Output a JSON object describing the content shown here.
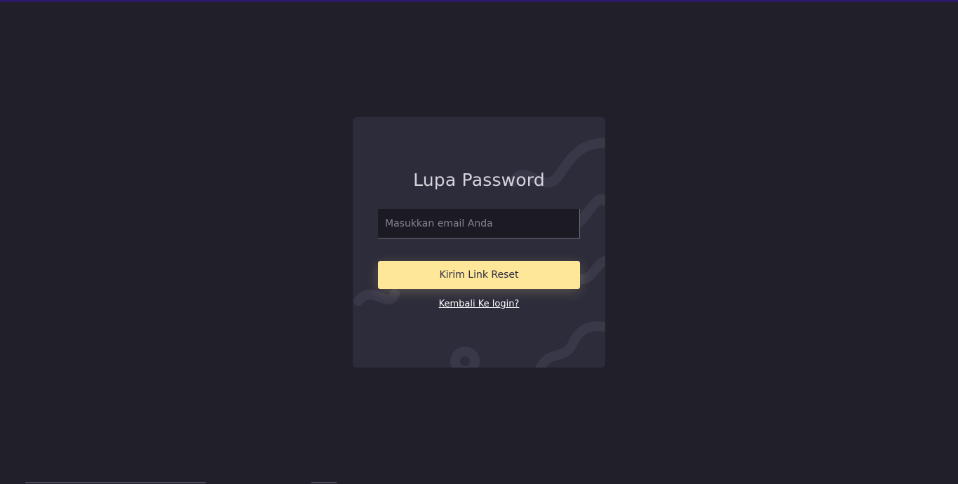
{
  "theme": {
    "background": "#21202a",
    "card": "#2c2c3a",
    "accent": "#ffe79a",
    "top_bar": "#2d1b69"
  },
  "form": {
    "title": "Lupa Password",
    "email_placeholder": "Masukkan email Anda",
    "email_value": "",
    "submit_label": "Kirim Link Reset",
    "back_link_label": "Kembali Ke login?"
  }
}
